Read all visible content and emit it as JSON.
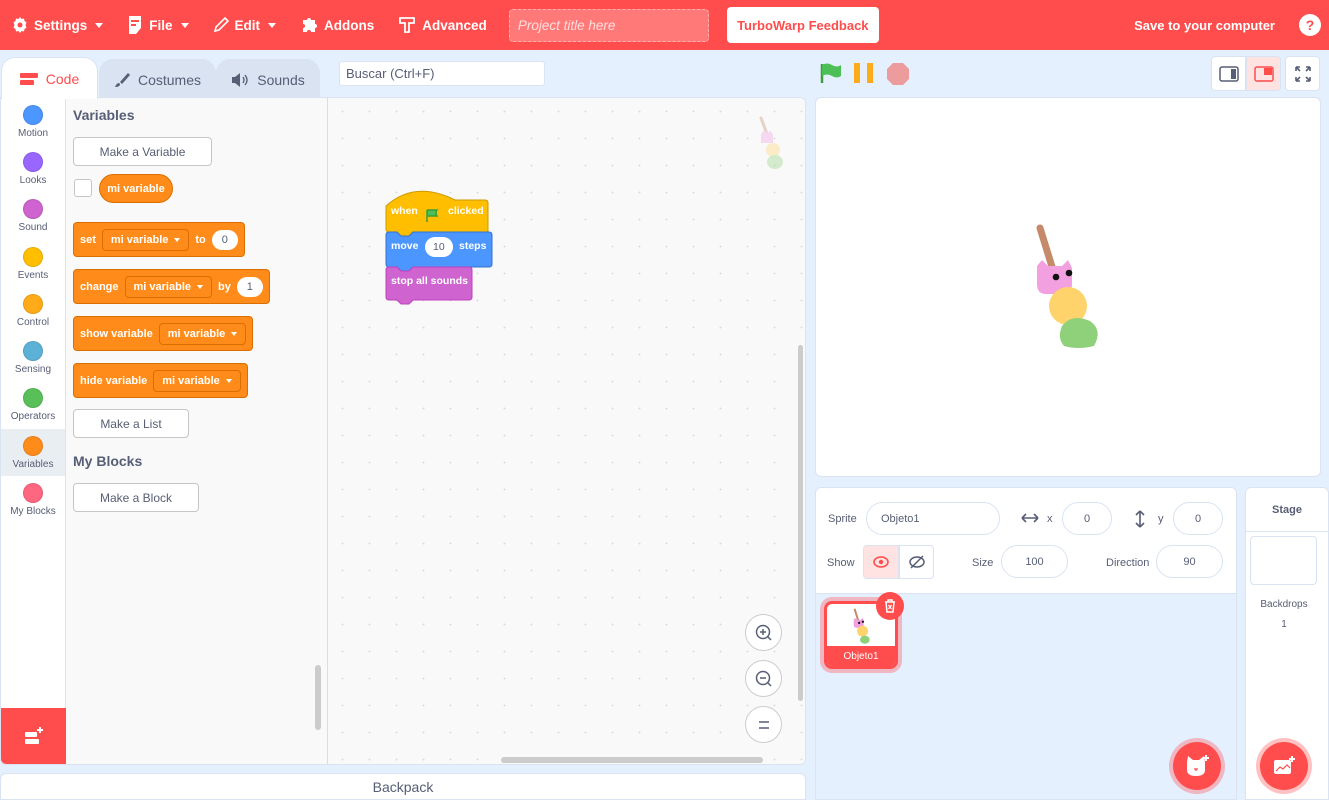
{
  "menubar": {
    "settings": "Settings",
    "file": "File",
    "edit": "Edit",
    "addons": "Addons",
    "advanced": "Advanced",
    "project_title_placeholder": "Project title here",
    "feedback": "TurboWarp Feedback",
    "save": "Save to your computer",
    "help": "?"
  },
  "tabs": [
    {
      "label": "Code",
      "active": true
    },
    {
      "label": "Costumes",
      "active": false
    },
    {
      "label": "Sounds",
      "active": false
    }
  ],
  "search": {
    "placeholder": "Buscar (Ctrl+F)"
  },
  "categories": [
    {
      "label": "Motion",
      "color": "#4c97ff"
    },
    {
      "label": "Looks",
      "color": "#9966ff"
    },
    {
      "label": "Sound",
      "color": "#cf63cf"
    },
    {
      "label": "Events",
      "color": "#ffbf00"
    },
    {
      "label": "Control",
      "color": "#ffab19"
    },
    {
      "label": "Sensing",
      "color": "#5cb1d6"
    },
    {
      "label": "Operators",
      "color": "#59c059"
    },
    {
      "label": "Variables",
      "color": "#ff8c1a",
      "selected": true
    },
    {
      "label": "My Blocks",
      "color": "#ff6680"
    }
  ],
  "palette": {
    "variables_heading": "Variables",
    "make_variable": "Make a Variable",
    "variable_name": "mi variable",
    "set_block": {
      "verb": "set",
      "var": "mi variable",
      "prep": "to",
      "value": "0"
    },
    "change_block": {
      "verb": "change",
      "var": "mi variable",
      "prep": "by",
      "value": "1"
    },
    "show_block": {
      "verb": "show variable",
      "var": "mi variable"
    },
    "hide_block": {
      "verb": "hide variable",
      "var": "mi variable"
    },
    "make_list": "Make a List",
    "myblocks_heading": "My Blocks",
    "make_block": "Make a Block"
  },
  "script": {
    "hat": {
      "when": "when",
      "clicked": "clicked"
    },
    "move": {
      "label": "move",
      "value": "10",
      "unit": "steps"
    },
    "stop": "stop all sounds"
  },
  "backpack": "Backpack",
  "sprite_info": {
    "sprite_label": "Sprite",
    "sprite_name": "Objeto1",
    "x_label": "x",
    "x": "0",
    "y_label": "y",
    "y": "0",
    "show_label": "Show",
    "size_label": "Size",
    "size": "100",
    "direction_label": "Direction",
    "direction": "90"
  },
  "sprites": [
    {
      "name": "Objeto1",
      "selected": true
    }
  ],
  "stage_pane": {
    "title": "Stage",
    "backdrops_label": "Backdrops",
    "backdrops_count": "1"
  },
  "colors": {
    "accent": "#ff4c4c",
    "variables": "#ff8c1a",
    "events": "#ffbf00",
    "motion": "#4c97ff",
    "sound": "#cf63cf"
  }
}
